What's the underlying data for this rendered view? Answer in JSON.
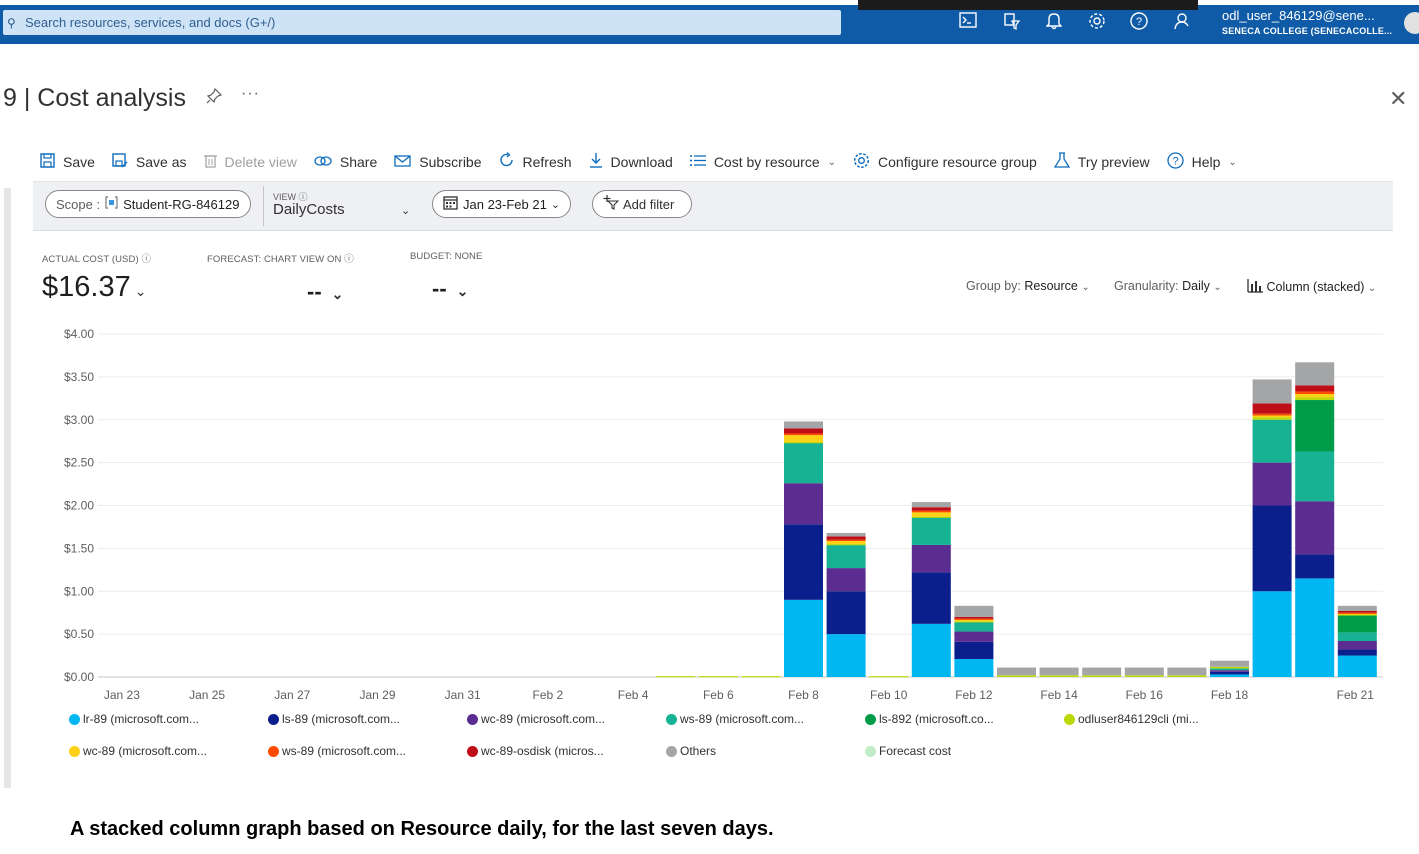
{
  "topbar": {
    "search_placeholder": "Search resources, services, and docs (G+/)",
    "user_name": "odl_user_846129@sene...",
    "user_org": "SENECA COLLEGE (SENECACOLLE...",
    "icons": [
      "cloud-shell-icon",
      "directory-filter-icon",
      "notifications-icon",
      "settings-icon",
      "help-icon",
      "feedback-icon"
    ]
  },
  "page": {
    "title": "9 | Cost analysis",
    "more": "···"
  },
  "toolbar": {
    "save": "Save",
    "save_as": "Save as",
    "delete_view": "Delete view",
    "share": "Share",
    "subscribe": "Subscribe",
    "refresh": "Refresh",
    "download": "Download",
    "cost_by_resource": "Cost by resource",
    "configure": "Configure resource group",
    "try_preview": "Try preview",
    "help": "Help"
  },
  "filters": {
    "scope_label": "Scope :",
    "scope_value": "Student-RG-846129",
    "view_label": "VIEW",
    "view_value": "DailyCosts",
    "date_range": "Jan 23-Feb 21",
    "add_filter": "Add filter"
  },
  "kpis": {
    "actual_label": "ACTUAL COST (USD)",
    "actual_value": "$16.37",
    "forecast_label": "FORECAST: CHART VIEW ON",
    "forecast_value": "--",
    "budget_label": "BUDGET: NONE",
    "budget_value": "--"
  },
  "controls": {
    "group_by_label": "Group by:",
    "group_by_value": "Resource",
    "granularity_label": "Granularity:",
    "granularity_value": "Daily",
    "chart_type": "Column (stacked)"
  },
  "chart_data": {
    "type": "bar",
    "stacked": true,
    "yticks": [
      "$0.00",
      "$0.50",
      "$1.00",
      "$1.50",
      "$2.00",
      "$2.50",
      "$3.00",
      "$3.50",
      "$4.00"
    ],
    "ylim": [
      0,
      4
    ],
    "x_labels": [
      "Jan 23",
      "Jan 25",
      "Jan 27",
      "Jan 29",
      "Jan 31",
      "Feb 2",
      "Feb 4",
      "Feb 6",
      "Feb 8",
      "Feb 10",
      "Feb 12",
      "Feb 14",
      "Feb 16",
      "Feb 18",
      "Feb 21"
    ],
    "days": [
      "Jan 23",
      "Jan 24",
      "Jan 25",
      "Jan 26",
      "Jan 27",
      "Jan 28",
      "Jan 29",
      "Jan 30",
      "Jan 31",
      "Feb 1",
      "Feb 2",
      "Feb 3",
      "Feb 4",
      "Feb 5",
      "Feb 6",
      "Feb 7",
      "Feb 8",
      "Feb 9",
      "Feb 10",
      "Feb 11",
      "Feb 12",
      "Feb 13",
      "Feb 14",
      "Feb 15",
      "Feb 16",
      "Feb 17",
      "Feb 18",
      "Feb 19",
      "Feb 20",
      "Feb 21"
    ],
    "series": [
      {
        "name": "lr-89 (microsoft.com...",
        "color": "#00b7f1",
        "values": [
          0,
          0,
          0,
          0,
          0,
          0,
          0,
          0,
          0,
          0,
          0,
          0,
          0,
          0,
          0,
          0,
          0.9,
          0.5,
          0,
          0.62,
          0.21,
          0,
          0,
          0,
          0,
          0,
          0.03,
          1.0,
          1.15,
          0.25
        ]
      },
      {
        "name": "ls-89 (microsoft.com...",
        "color": "#0a1e8c",
        "values": [
          0,
          0,
          0,
          0,
          0,
          0,
          0,
          0,
          0,
          0,
          0,
          0,
          0,
          0,
          0,
          0,
          0.88,
          0.5,
          0,
          0.6,
          0.2,
          0,
          0,
          0,
          0,
          0,
          0.03,
          1.0,
          0.28,
          0.07
        ]
      },
      {
        "name": "wc-89 (microsoft.com...",
        "color": "#5c2d91",
        "values": [
          0,
          0,
          0,
          0,
          0,
          0,
          0,
          0,
          0,
          0,
          0,
          0,
          0,
          0,
          0,
          0,
          0.48,
          0.27,
          0,
          0.32,
          0.12,
          0,
          0,
          0,
          0,
          0,
          0.02,
          0.5,
          0.62,
          0.1
        ]
      },
      {
        "name": "ws-89 (microsoft.com...",
        "color": "#17b294",
        "values": [
          0,
          0,
          0,
          0,
          0,
          0,
          0,
          0,
          0,
          0,
          0,
          0,
          0,
          0,
          0,
          0,
          0.47,
          0.27,
          0,
          0.32,
          0.11,
          0,
          0,
          0,
          0,
          0,
          0.02,
          0.5,
          0.58,
          0.1
        ]
      },
      {
        "name": "ls-892 (microsoft.co...",
        "color": "#009c4a",
        "values": [
          0,
          0,
          0,
          0,
          0,
          0,
          0,
          0,
          0,
          0,
          0,
          0,
          0,
          0,
          0,
          0,
          0,
          0,
          0,
          0,
          0,
          0,
          0,
          0,
          0,
          0,
          0,
          0,
          0.6,
          0.2
        ]
      },
      {
        "name": "odluser846129cli (mi...",
        "color": "#bad80a",
        "values": [
          0,
          0,
          0,
          0,
          0,
          0,
          0,
          0,
          0,
          0,
          0,
          0,
          0,
          0.01,
          0.01,
          0.01,
          0.01,
          0.01,
          0.01,
          0.01,
          0.01,
          0.02,
          0.02,
          0.02,
          0.02,
          0.02,
          0.02,
          0.03,
          0.03,
          0.01
        ]
      },
      {
        "name": "wc-89 (microsoft.com...",
        "color": "#fcd116",
        "values": [
          0,
          0,
          0,
          0,
          0,
          0,
          0,
          0,
          0,
          0,
          0,
          0,
          0,
          0,
          0,
          0,
          0.08,
          0.04,
          0,
          0.05,
          0.02,
          0,
          0,
          0,
          0,
          0,
          0,
          0.02,
          0.04,
          0.01
        ]
      },
      {
        "name": "ws-89 (microsoft.com...",
        "color": "#ff4b00",
        "values": [
          0,
          0,
          0,
          0,
          0,
          0,
          0,
          0,
          0,
          0,
          0,
          0,
          0,
          0,
          0,
          0,
          0.02,
          0.01,
          0,
          0.02,
          0.01,
          0,
          0,
          0,
          0,
          0,
          0,
          0.02,
          0.03,
          0.01
        ]
      },
      {
        "name": "wc-89-osdisk (micros...",
        "color": "#c00e18",
        "values": [
          0,
          0,
          0,
          0,
          0,
          0,
          0,
          0,
          0,
          0,
          0,
          0,
          0,
          0,
          0,
          0,
          0.06,
          0.04,
          0,
          0.04,
          0.02,
          0,
          0,
          0,
          0,
          0,
          0,
          0.12,
          0.07,
          0.02
        ]
      },
      {
        "name": "Others",
        "color": "#a4a5a6",
        "values": [
          0,
          0,
          0,
          0,
          0,
          0,
          0,
          0,
          0,
          0,
          0,
          0,
          0,
          0,
          0,
          0,
          0.08,
          0.04,
          0,
          0.06,
          0.13,
          0.09,
          0.09,
          0.09,
          0.09,
          0.09,
          0.07,
          0.28,
          0.27,
          0.06
        ]
      },
      {
        "name": "Forecast cost",
        "color": "#c2ecc7",
        "values": [
          0,
          0,
          0,
          0,
          0,
          0,
          0,
          0,
          0,
          0,
          0,
          0,
          0,
          0,
          0,
          0,
          0,
          0,
          0,
          0,
          0,
          0,
          0,
          0,
          0,
          0,
          0,
          0,
          0,
          0
        ]
      }
    ]
  },
  "caption": "A stacked column graph based on Resource daily, for the last seven days."
}
